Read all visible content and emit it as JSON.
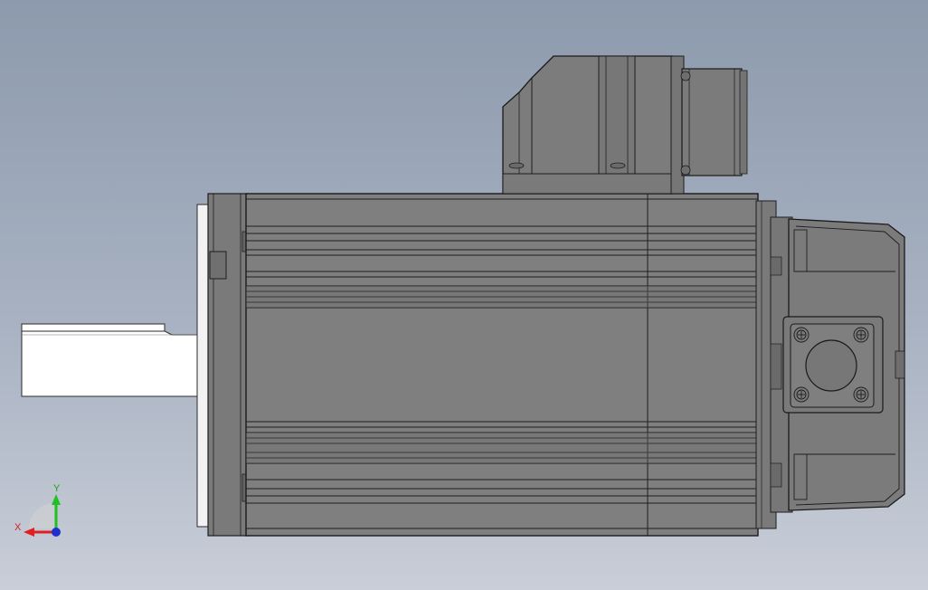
{
  "viewport": {
    "view": "cad-3d-viewport",
    "model": "servo-motor-side-view",
    "background": {
      "top": "#8d9aad",
      "bottom": "#c9ced8"
    }
  },
  "colors": {
    "body": "#7d7d7d",
    "body_dark": "#6f6f6f",
    "edge": "#1e1e1e",
    "shaft": "#ffffff",
    "axis_x": "#e02020",
    "axis_y": "#20c020",
    "axis_z": "#2030d0"
  },
  "triad": {
    "x_label": "X",
    "y_label": "Y"
  }
}
